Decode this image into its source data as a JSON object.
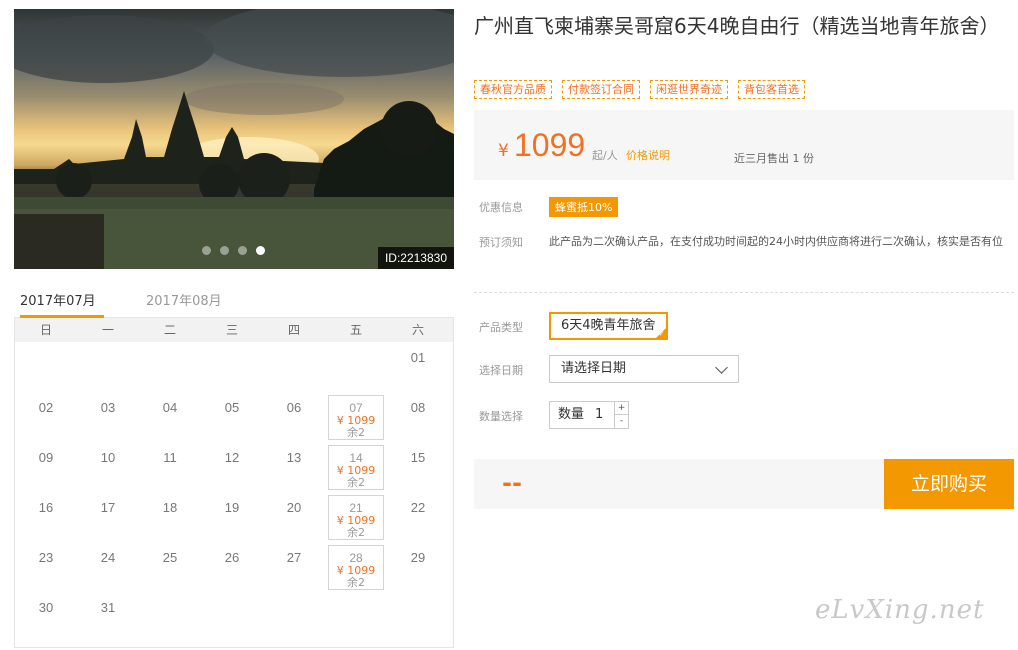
{
  "hero": {
    "image_id": "ID:2213830",
    "dots": [
      false,
      false,
      false,
      true
    ]
  },
  "calendar": {
    "tabs": [
      {
        "label": "2017年07月",
        "active": true
      },
      {
        "label": "2017年08月",
        "active": false
      }
    ],
    "weekdays": [
      "日",
      "一",
      "二",
      "三",
      "四",
      "五",
      "六"
    ],
    "weeks": [
      [
        null,
        null,
        null,
        null,
        null,
        null,
        {
          "d": "01"
        }
      ],
      [
        {
          "d": "02"
        },
        {
          "d": "03"
        },
        {
          "d": "04"
        },
        {
          "d": "05"
        },
        {
          "d": "06"
        },
        {
          "d": "07",
          "price": "¥ 1099",
          "remain": "余2"
        },
        {
          "d": "08"
        }
      ],
      [
        {
          "d": "09"
        },
        {
          "d": "10"
        },
        {
          "d": "11"
        },
        {
          "d": "12"
        },
        {
          "d": "13"
        },
        {
          "d": "14",
          "price": "¥ 1099",
          "remain": "余2"
        },
        {
          "d": "15"
        }
      ],
      [
        {
          "d": "16"
        },
        {
          "d": "17"
        },
        {
          "d": "18"
        },
        {
          "d": "19"
        },
        {
          "d": "20"
        },
        {
          "d": "21",
          "price": "¥ 1099",
          "remain": "余2"
        },
        {
          "d": "22"
        }
      ],
      [
        {
          "d": "23"
        },
        {
          "d": "24"
        },
        {
          "d": "25"
        },
        {
          "d": "26"
        },
        {
          "d": "27"
        },
        {
          "d": "28",
          "price": "¥ 1099",
          "remain": "余2"
        },
        {
          "d": "29"
        }
      ],
      [
        {
          "d": "30"
        },
        {
          "d": "31"
        },
        null,
        null,
        null,
        null,
        null
      ]
    ]
  },
  "product": {
    "title": "广州直飞柬埔寨吴哥窟6天4晚自由行（精选当地青年旅舍）",
    "tags": [
      "春秋官方品质",
      "付款签订合同",
      "闲逛世界奇迹",
      "背包客首选"
    ],
    "price": {
      "currency": "¥",
      "value": "1099",
      "unit": "起/人",
      "link": "价格说明",
      "sold": "近三月售出 1 份"
    },
    "discount_label": "优惠信息",
    "discount_badge": "蜂蜜抵10%",
    "notice_label": "预订须知",
    "notice_text": "此产品为二次确认产品，在支付成功时间起的24小时内供应商将进行二次确认，核实是否有位",
    "type_label": "产品类型",
    "type_value": "6天4晚青年旅舍",
    "date_label": "选择日期",
    "date_placeholder": "请选择日期",
    "qty_label": "数量选择",
    "qty_text": "数量",
    "qty_value": "1",
    "qty_plus": "+",
    "qty_minus": "-",
    "total": "--",
    "buy_button": "立即购买"
  },
  "watermark": "eLvXing.net",
  "colors": {
    "accent": "#f39800",
    "price": "#f37021"
  }
}
